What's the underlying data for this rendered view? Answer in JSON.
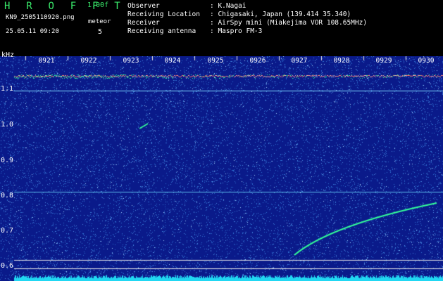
{
  "header": {
    "app_name": "H R O F F T",
    "version": "1.00f",
    "file_name": "KN9_2505110920.png",
    "date_time": "25.05.11 09:20",
    "meteor_label": "meteor",
    "meteor_count": "5"
  },
  "info": [
    {
      "label": "Observer",
      "value": ": K.Nagai"
    },
    {
      "label": "Receiving Location",
      "value": ": Chigasaki, Japan (139.414 35.340)"
    },
    {
      "label": "Receiver",
      "value": ": AirSpy mini (Miakejima VOR 108.65MHz)"
    },
    {
      "label": "Receiving antenna",
      "value": ": Maspro FM-3"
    }
  ],
  "spectrogram": {
    "y_unit": "kHz",
    "y_ticks": [
      "1.1",
      "1.0",
      "0.9",
      "0.8",
      "0.7",
      "0.6"
    ],
    "x_ticks": [
      "0921",
      "0922",
      "0923",
      "0924",
      "0925",
      "0926",
      "0927",
      "0928",
      "0929",
      "0930"
    ],
    "colors": {
      "background": "#0a1a8a",
      "noise": "#2f6fd0",
      "signal": "#33ff99",
      "carrier": "#ff6a6a",
      "floor": "#21d7f2",
      "grid_line": "#e8e8e8"
    }
  }
}
